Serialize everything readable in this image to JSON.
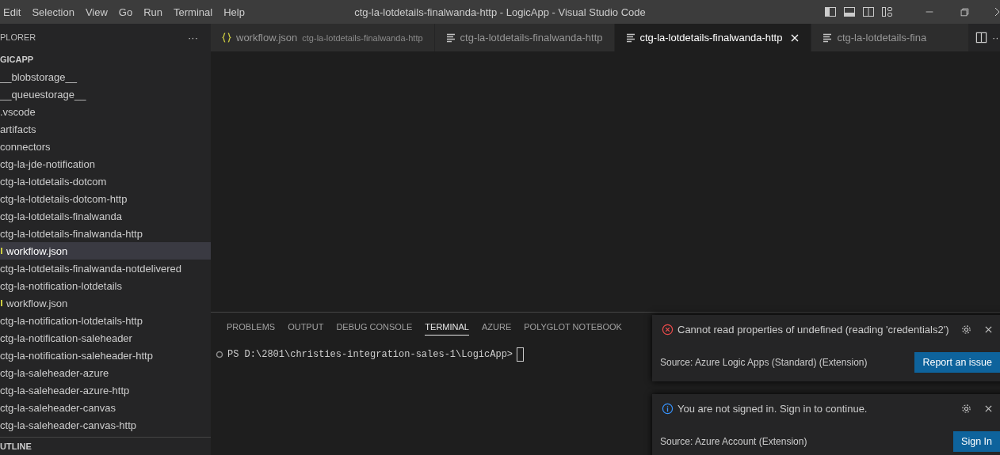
{
  "menu": [
    "Edit",
    "Selection",
    "View",
    "Go",
    "Run",
    "Terminal",
    "Help"
  ],
  "window": {
    "title": "ctg-la-lotdetails-finalwanda-http - LogicApp - Visual Studio Code"
  },
  "sidebar": {
    "title": "PLORER",
    "more": "···",
    "folder": "GICAPP",
    "items": [
      {
        "label": "__blobstorage__",
        "kind": "folder",
        "selected": false
      },
      {
        "label": "__queuestorage__",
        "kind": "folder",
        "selected": false
      },
      {
        "label": ".vscode",
        "kind": "folder",
        "selected": false
      },
      {
        "label": "artifacts",
        "kind": "folder",
        "selected": false
      },
      {
        "label": "connectors",
        "kind": "folder",
        "selected": false
      },
      {
        "label": "ctg-la-jde-notification",
        "kind": "folder",
        "selected": false
      },
      {
        "label": "ctg-la-lotdetails-dotcom",
        "kind": "folder",
        "selected": false
      },
      {
        "label": "ctg-la-lotdetails-dotcom-http",
        "kind": "folder",
        "selected": false
      },
      {
        "label": "ctg-la-lotdetails-finalwanda",
        "kind": "folder",
        "selected": false
      },
      {
        "label": "ctg-la-lotdetails-finalwanda-http",
        "kind": "folder",
        "selected": false
      },
      {
        "label": "workflow.json",
        "kind": "json",
        "selected": true
      },
      {
        "label": "ctg-la-lotdetails-finalwanda-notdelivered",
        "kind": "folder",
        "selected": false
      },
      {
        "label": "ctg-la-notification-lotdetails",
        "kind": "folder",
        "selected": false
      },
      {
        "label": "workflow.json",
        "kind": "json",
        "selected": false
      },
      {
        "label": "ctg-la-notification-lotdetails-http",
        "kind": "folder",
        "selected": false
      },
      {
        "label": "ctg-la-notification-saleheader",
        "kind": "folder",
        "selected": false
      },
      {
        "label": "ctg-la-notification-saleheader-http",
        "kind": "folder",
        "selected": false
      },
      {
        "label": "ctg-la-saleheader-azure",
        "kind": "folder",
        "selected": false
      },
      {
        "label": "ctg-la-saleheader-azure-http",
        "kind": "folder",
        "selected": false
      },
      {
        "label": "ctg-la-saleheader-canvas",
        "kind": "folder",
        "selected": false
      },
      {
        "label": "ctg-la-saleheader-canvas-http",
        "kind": "folder",
        "selected": false
      }
    ],
    "outline": "UTLINE"
  },
  "tabs": [
    {
      "label": "workflow.json",
      "description": "ctg-la-lotdetails-finalwanda-http",
      "kind": "json",
      "selected": false
    },
    {
      "label": "ctg-la-lotdetails-finalwanda-http",
      "kind": "text",
      "selected": false
    },
    {
      "label": "ctg-la-lotdetails-finalwanda-http",
      "kind": "text",
      "selected": true
    },
    {
      "label": "ctg-la-lotdetails-fina",
      "kind": "text",
      "selected": false
    }
  ],
  "tab_more": "···",
  "panel": {
    "tabs": [
      {
        "label": "PROBLEMS",
        "selected": false
      },
      {
        "label": "OUTPUT",
        "selected": false
      },
      {
        "label": "DEBUG CONSOLE",
        "selected": false
      },
      {
        "label": "TERMINAL",
        "selected": true
      },
      {
        "label": "AZURE",
        "selected": false
      },
      {
        "label": "POLYGLOT NOTEBOOK",
        "selected": false
      }
    ],
    "prompt": "PS D:\\2801\\christies-integration-sales-1\\LogicApp>"
  },
  "notifications": [
    {
      "kind": "error",
      "message": "Cannot read properties of undefined (reading 'credentials2')",
      "source": "Source: Azure Logic Apps (Standard) (Extension)",
      "button": "Report an issue"
    },
    {
      "kind": "info",
      "message": "You are not signed in. Sign in to continue.",
      "source": "Source: Azure Account (Extension)",
      "button": "Sign In"
    }
  ]
}
